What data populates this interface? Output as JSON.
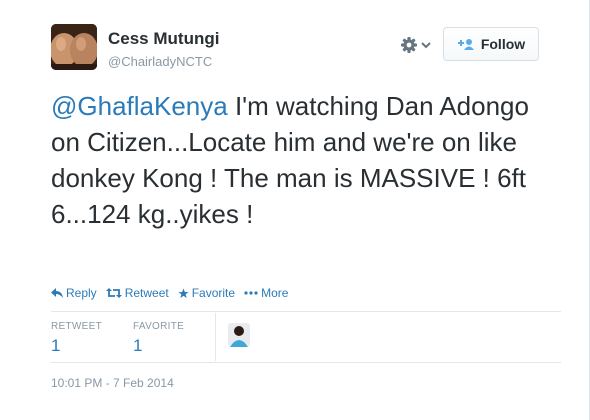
{
  "tweet": {
    "author_name": "Cess Mutungi",
    "author_handle": "@ChairladyNCTC",
    "follow_label": "Follow",
    "mention": "@GhaflaKenya",
    "text": " I'm watching Dan Adongo on Citizen...Locate him and we're on like donkey Kong ! The man is MASSIVE ! 6ft 6...124 kg..yikes !",
    "timestamp": "10:01 PM - 7 Feb 2014"
  },
  "actions": {
    "reply": "Reply",
    "retweet": "Retweet",
    "favorite": "Favorite",
    "more": "More"
  },
  "stats": {
    "retweets_label": "RETWEET",
    "retweets_count": "1",
    "favorites_label": "FAVORITE",
    "favorites_count": "1"
  },
  "colors": {
    "link": "#2b7bb9",
    "text": "#292f33",
    "muted": "#8899a6",
    "icon_blue": "#55acee"
  },
  "icons": [
    "gear-icon",
    "chevron-down-icon",
    "follow-user-icon",
    "reply-icon",
    "retweet-icon",
    "favorite-star-icon",
    "more-dots-icon"
  ]
}
